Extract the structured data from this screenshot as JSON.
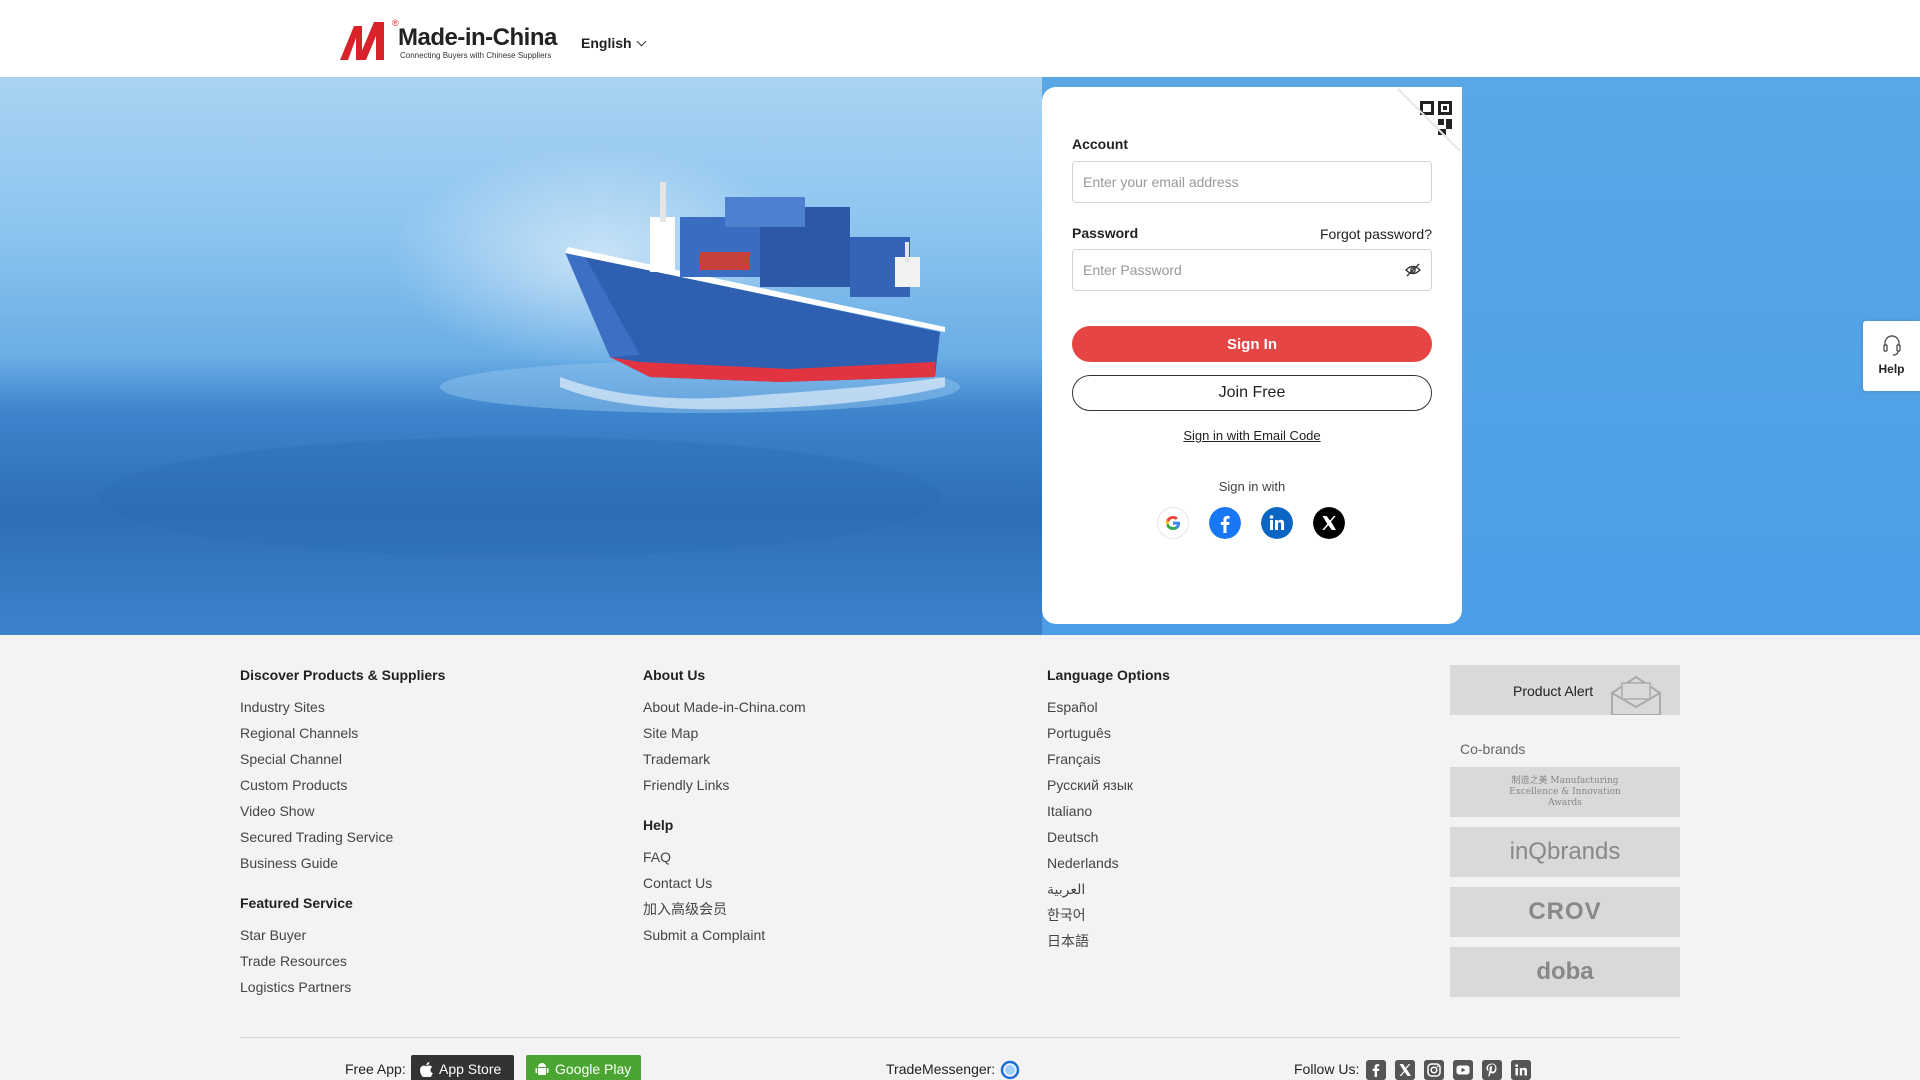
{
  "header": {
    "logo_text": "Made-in-China",
    "logo_tagline": "Connecting Buyers with Chinese Suppliers",
    "logo_reg": "®",
    "language": "English"
  },
  "login": {
    "account_label": "Account",
    "account_placeholder": "Enter your email address",
    "password_label": "Password",
    "password_placeholder": "Enter Password",
    "forgot": "Forgot password?",
    "sign_in": "Sign In",
    "join": "Join Free",
    "email_code": "Sign in with Email Code",
    "sign_in_with": "Sign in with",
    "social": [
      "google-icon",
      "facebook-icon",
      "linkedin-icon",
      "x-icon"
    ]
  },
  "help_float": {
    "label": "Help"
  },
  "footer": {
    "discover": {
      "title": "Discover Products & Suppliers",
      "links": [
        "Industry Sites",
        "Regional Channels",
        "Special Channel",
        "Custom Products",
        "Video Show",
        "Secured Trading Service",
        "Business Guide"
      ]
    },
    "featured": {
      "title": "Featured Service",
      "links": [
        "Star Buyer",
        "Trade Resources",
        "Logistics Partners"
      ]
    },
    "about": {
      "title": "About Us",
      "links": [
        "About Made-in-China.com",
        "Site Map",
        "Trademark",
        "Friendly Links"
      ]
    },
    "help": {
      "title": "Help",
      "links": [
        "FAQ",
        "Contact Us",
        "加入高级会员",
        "Submit a Complaint"
      ]
    },
    "languages": {
      "title": "Language Options",
      "links": [
        "Español",
        "Português",
        "Français",
        "Русский язык",
        "Italiano",
        "Deutsch",
        "Nederlands",
        "العربية",
        "한국어",
        "日本語"
      ]
    },
    "product_alert": "Product Alert",
    "cobrands_title": "Co-brands",
    "cobrands": [
      "制造之美 Manufacturing Excellence & Innovation Awards",
      "inQbrands",
      "CROV",
      "doba"
    ],
    "free_app": "Free App:",
    "app_store": "App Store",
    "google_play": "Google Play",
    "trade_messenger": "TradeMessenger:",
    "follow_us": "Follow Us:",
    "follow_icons": [
      "facebook-icon",
      "x-icon",
      "instagram-icon",
      "youtube-icon",
      "pinterest-icon",
      "linkedin-icon"
    ]
  },
  "colors": {
    "brand_red": "#d8232a",
    "signin_button": "#e64545",
    "hero_blue": "#4b9de6",
    "google_play_green": "#4aa532"
  }
}
